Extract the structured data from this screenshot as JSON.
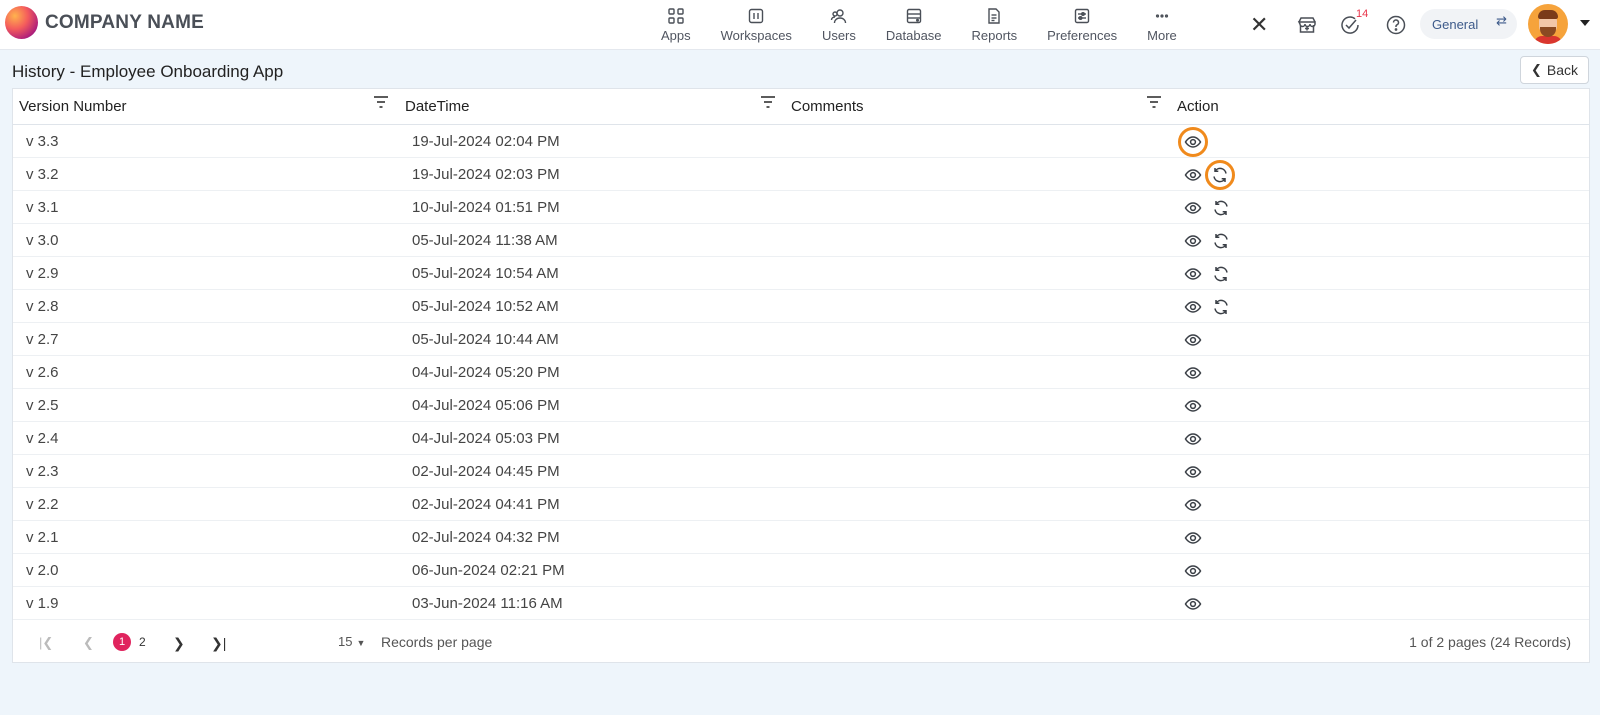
{
  "brand": {
    "name": "COMPANY NAME"
  },
  "nav": [
    {
      "label": "Apps",
      "icon": "apps-grid-icon"
    },
    {
      "label": "Workspaces",
      "icon": "workspaces-icon"
    },
    {
      "label": "Users",
      "icon": "users-icon"
    },
    {
      "label": "Database",
      "icon": "database-icon"
    },
    {
      "label": "Reports",
      "icon": "reports-icon"
    },
    {
      "label": "Preferences",
      "icon": "preferences-icon"
    },
    {
      "label": "More",
      "icon": "more-dots-icon"
    }
  ],
  "header": {
    "close_glyph": "✕",
    "tasks_count": "14",
    "workspace_label": "General"
  },
  "page": {
    "title": "History - Employee Onboarding App",
    "back_label": "Back"
  },
  "table": {
    "columns": [
      "Version Number",
      "DateTime",
      "Comments",
      "Action"
    ],
    "rows": [
      {
        "version": "v 3.3",
        "datetime": "19-Jul-2024 02:04 PM",
        "comments": "",
        "restore": false
      },
      {
        "version": "v 3.2",
        "datetime": "19-Jul-2024 02:03 PM",
        "comments": "",
        "restore": true
      },
      {
        "version": "v 3.1",
        "datetime": "10-Jul-2024 01:51 PM",
        "comments": "",
        "restore": true
      },
      {
        "version": "v 3.0",
        "datetime": "05-Jul-2024 11:38 AM",
        "comments": "",
        "restore": true
      },
      {
        "version": "v 2.9",
        "datetime": "05-Jul-2024 10:54 AM",
        "comments": "",
        "restore": true
      },
      {
        "version": "v 2.8",
        "datetime": "05-Jul-2024 10:52 AM",
        "comments": "",
        "restore": true
      },
      {
        "version": "v 2.7",
        "datetime": "05-Jul-2024 10:44 AM",
        "comments": "",
        "restore": false
      },
      {
        "version": "v 2.6",
        "datetime": "04-Jul-2024 05:20 PM",
        "comments": "",
        "restore": false
      },
      {
        "version": "v 2.5",
        "datetime": "04-Jul-2024 05:06 PM",
        "comments": "",
        "restore": false
      },
      {
        "version": "v 2.4",
        "datetime": "04-Jul-2024 05:03 PM",
        "comments": "",
        "restore": false
      },
      {
        "version": "v 2.3",
        "datetime": "02-Jul-2024 04:45 PM",
        "comments": "",
        "restore": false
      },
      {
        "version": "v 2.2",
        "datetime": "02-Jul-2024 04:41 PM",
        "comments": "",
        "restore": false
      },
      {
        "version": "v 2.1",
        "datetime": "02-Jul-2024 04:32 PM",
        "comments": "",
        "restore": false
      },
      {
        "version": "v 2.0",
        "datetime": "06-Jun-2024 02:21 PM",
        "comments": "",
        "restore": false
      },
      {
        "version": "v 1.9",
        "datetime": "03-Jun-2024 11:16 AM",
        "comments": "",
        "restore": false
      }
    ]
  },
  "pagination": {
    "current_page": "1",
    "other_page": "2",
    "per_page": "15",
    "per_page_label": "Records per page",
    "info": "1 of 2 pages (24 Records)"
  },
  "colors": {
    "highlight_ring": "#f08a1c",
    "active_page": "#e0245e",
    "badge": "#e8344a"
  }
}
